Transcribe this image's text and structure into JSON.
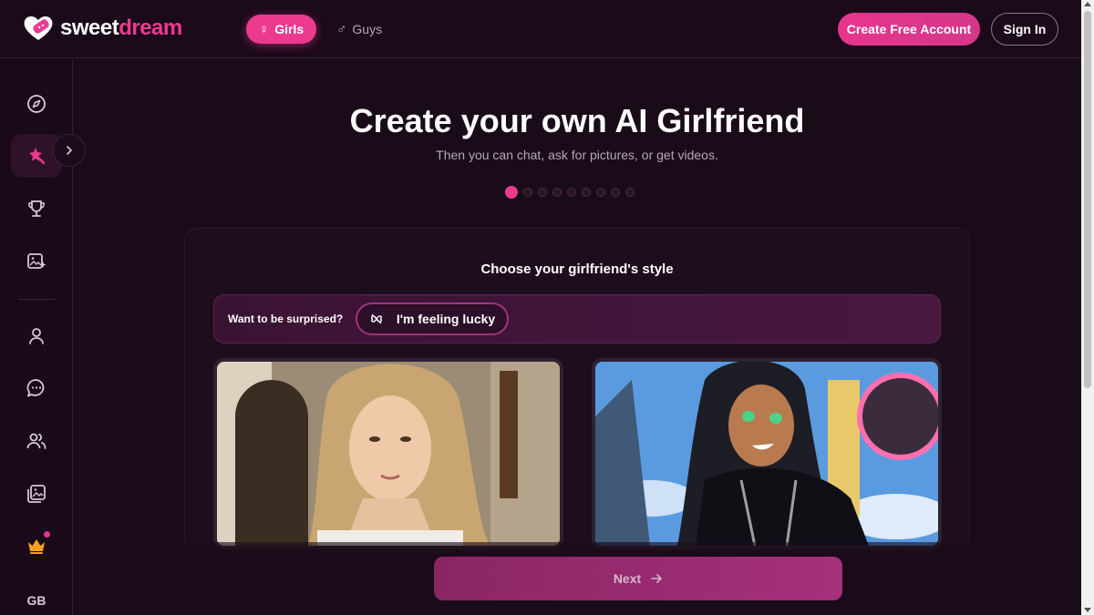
{
  "header": {
    "logo_sweet": "sweet",
    "logo_dream": "dream",
    "tabs": [
      {
        "label": "Girls",
        "symbol": "♀"
      },
      {
        "label": "Guys",
        "symbol": "♂"
      }
    ],
    "create_account_label": "Create Free Account",
    "signin_label": "Sign In"
  },
  "sidebar": {
    "items": [
      {
        "name": "explore",
        "icon": "compass-icon"
      },
      {
        "name": "create",
        "icon": "magic-wand-icon"
      },
      {
        "name": "leaderboard",
        "icon": "trophy-icon"
      },
      {
        "name": "generate-image",
        "icon": "image-sparkle-icon"
      },
      {
        "name": "profile",
        "icon": "user-icon"
      },
      {
        "name": "chat",
        "icon": "chat-icon"
      },
      {
        "name": "characters",
        "icon": "users-icon"
      },
      {
        "name": "gallery",
        "icon": "gallery-icon"
      },
      {
        "name": "premium",
        "icon": "crown-icon"
      }
    ],
    "language": "GB"
  },
  "main": {
    "title": "Create your own AI Girlfriend",
    "subtitle": "Then you can chat, ask for pictures, or get videos.",
    "step_current": 1,
    "step_total": 9,
    "card_title": "Choose your girlfriend's style",
    "surprise_label": "Want to be surprised?",
    "lucky_label": "I'm feeling lucky",
    "next_label": "Next"
  },
  "colors": {
    "accent": "#ec3a8f",
    "background": "#1a0b19"
  }
}
